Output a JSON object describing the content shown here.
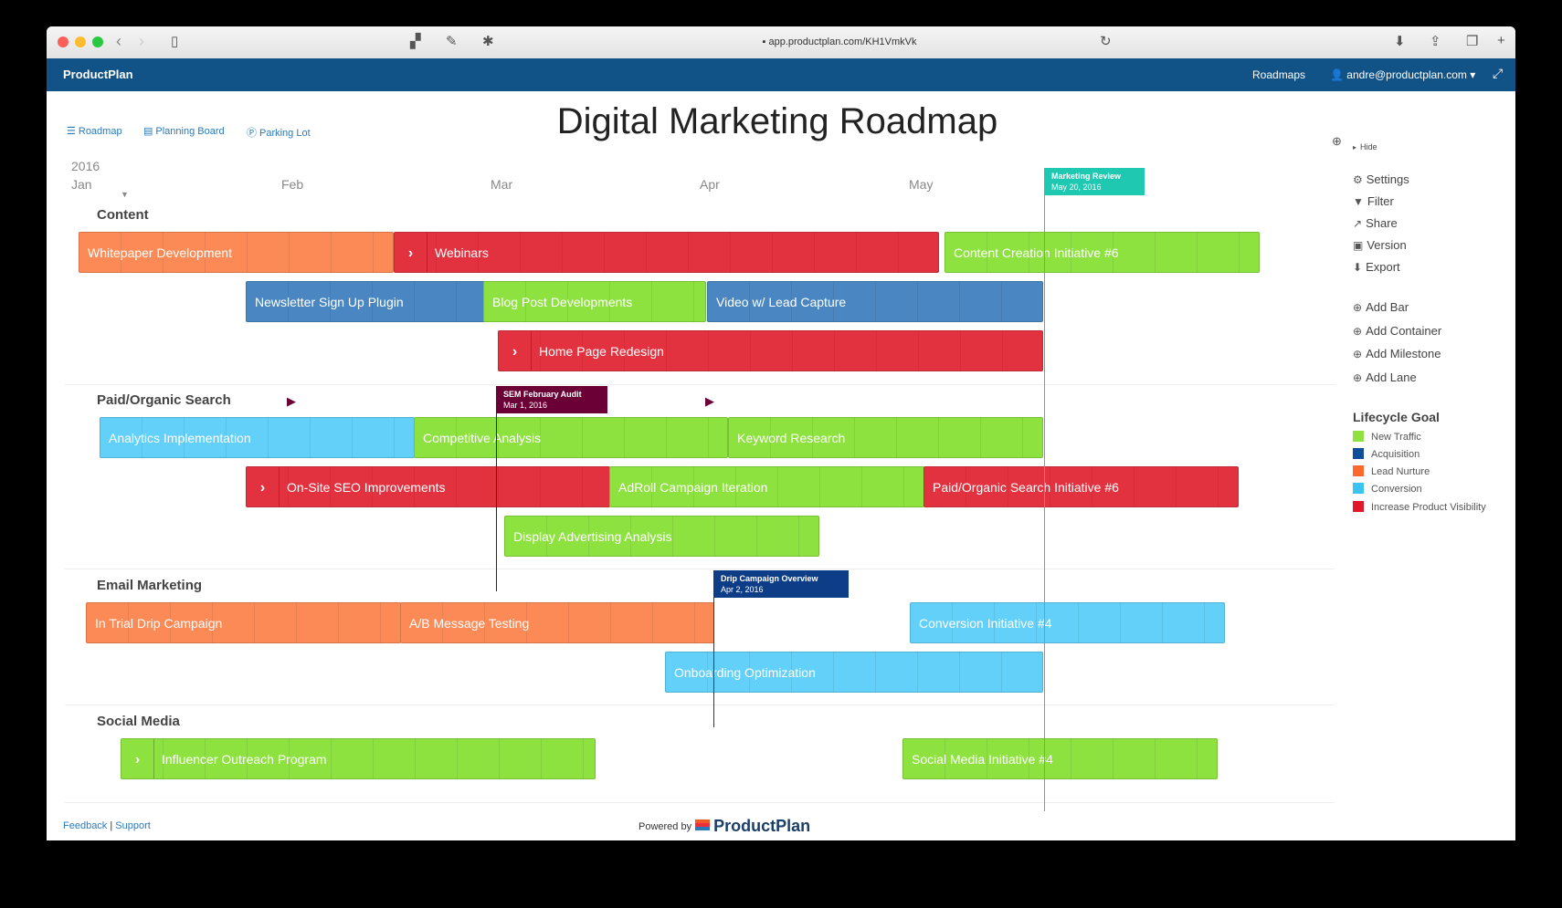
{
  "browser": {
    "url": "app.productplan.com/KH1VmkVk"
  },
  "appbar": {
    "brand": "ProductPlan",
    "roadmaps": "Roadmaps",
    "user": "andre@productplan.com ▾"
  },
  "views": {
    "roadmap": "Roadmap",
    "planning_board": "Planning Board",
    "parking_lot": "Parking Lot"
  },
  "title": "Digital Marketing Roadmap",
  "timeline": {
    "year": "2016",
    "months": [
      "Jan",
      "Feb",
      "Mar",
      "Apr",
      "May"
    ]
  },
  "lanes": [
    {
      "name": "Content"
    },
    {
      "name": "Paid/Organic Search"
    },
    {
      "name": "Email Marketing"
    },
    {
      "name": "Social Media"
    }
  ],
  "bars": [
    {
      "label": "Whitepaper Development",
      "goal": "Lead Nurture",
      "container": false
    },
    {
      "label": "Webinars",
      "goal": "Increase Product Visibility",
      "container": true
    },
    {
      "label": "Content Creation Initiative #6",
      "goal": "New Traffic",
      "container": false
    },
    {
      "label": "Newsletter Sign Up Plugin",
      "goal": "Acquisition",
      "container": false
    },
    {
      "label": "Blog Post Developments",
      "goal": "New Traffic",
      "container": false
    },
    {
      "label": "Video w/ Lead Capture",
      "goal": "Acquisition",
      "container": false
    },
    {
      "label": "Home Page Redesign",
      "goal": "Increase Product Visibility",
      "container": true
    },
    {
      "label": "Analytics Implementation",
      "goal": "Conversion",
      "container": false
    },
    {
      "label": "Competitive Analysis",
      "goal": "New Traffic",
      "container": false
    },
    {
      "label": "Keyword Research",
      "goal": "New Traffic",
      "container": false
    },
    {
      "label": "On-Site SEO Improvements",
      "goal": "Increase Product Visibility",
      "container": true
    },
    {
      "label": "AdRoll Campaign Iteration",
      "goal": "New Traffic",
      "container": false
    },
    {
      "label": "Paid/Organic Search Initiative #6",
      "goal": "Increase Product Visibility",
      "container": false
    },
    {
      "label": "Display Advertising Analysis",
      "goal": "New Traffic",
      "container": false
    },
    {
      "label": "In Trial Drip Campaign",
      "goal": "Lead Nurture",
      "container": false
    },
    {
      "label": "A/B Message Testing",
      "goal": "Lead Nurture",
      "container": false
    },
    {
      "label": "Conversion Initiative #4",
      "goal": "Conversion",
      "container": false
    },
    {
      "label": "Onboarding Optimization",
      "goal": "Conversion",
      "container": false
    },
    {
      "label": "Influencer Outreach Program",
      "goal": "New Traffic",
      "container": true
    },
    {
      "label": "Social Media Initiative #4",
      "goal": "New Traffic",
      "container": false
    }
  ],
  "milestones": [
    {
      "name": "Marketing Review",
      "date": "May 20, 2016",
      "color": "#1fc8b0"
    },
    {
      "name": "SEM February Audit",
      "date": "Mar 1, 2016",
      "color": "#6b0036"
    },
    {
      "name": "Drip Campaign Overview",
      "date": "Apr 2, 2016",
      "color": "#0e3d88"
    }
  ],
  "panel": {
    "hide": "Hide",
    "actions": [
      "Settings",
      "Filter",
      "Share",
      "Version",
      "Export"
    ],
    "add": [
      "Add Bar",
      "Add Container",
      "Add Milestone",
      "Add Lane"
    ],
    "legend_title": "Lifecycle Goal",
    "legend": [
      {
        "label": "New Traffic",
        "color": "#8ee23f"
      },
      {
        "label": "Acquisition",
        "color": "#0e4e9a"
      },
      {
        "label": "Lead Nurture",
        "color": "#fb6a2c"
      },
      {
        "label": "Conversion",
        "color": "#3cc3f5"
      },
      {
        "label": "Increase Product Visibility",
        "color": "#e2182a"
      }
    ]
  },
  "footer": {
    "feedback": "Feedback",
    "support": "Support",
    "powered_by": "Powered by",
    "brand": "ProductPlan"
  }
}
